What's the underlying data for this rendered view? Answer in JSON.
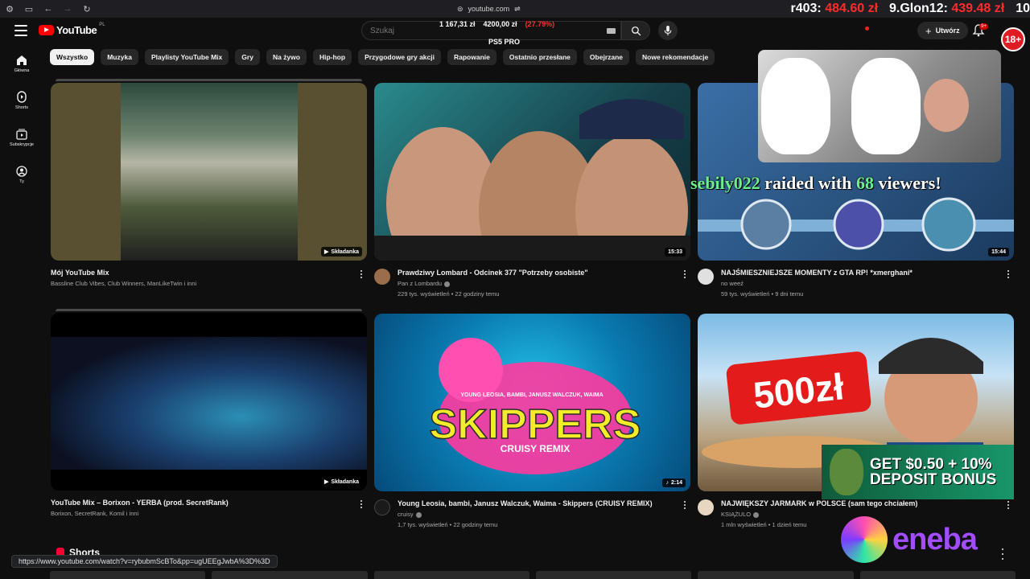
{
  "browser": {
    "url": "youtube.com",
    "status_url": "https://www.youtube.com/watch?v=rybubmScBTo&pp=ugUEEgJwbA%3D%3D"
  },
  "stream_overlay": {
    "ticker": [
      {
        "label": "r403:",
        "value": "484.60 zł"
      },
      {
        "label": "9.Glon12:",
        "value": "439.48 zł"
      },
      {
        "label": "10",
        "value": ""
      }
    ],
    "stock_left": "1 167,31 zł",
    "stock_mid": "4200,00 zł",
    "stock_change": "(27.79%)",
    "ps5": "PS5 PRO",
    "age_badge": "18+",
    "raid": {
      "name": "sebily022",
      "text1": "raided with",
      "count": "68",
      "text2": "viewers!"
    },
    "promo_text": "GET $0.50 + 10% DEPOSIT BONUS",
    "eneba": "eneba"
  },
  "header": {
    "logo": "YouTube",
    "region": "PL",
    "search_placeholder": "Szukaj",
    "create_label": "Utwórz",
    "notif_count": "9+"
  },
  "sidebar": {
    "items": [
      {
        "label": "Główna",
        "icon": "home-icon"
      },
      {
        "label": "Shorts",
        "icon": "shorts-icon"
      },
      {
        "label": "Subskrypcje",
        "icon": "subscriptions-icon"
      },
      {
        "label": "Ty",
        "icon": "you-icon"
      }
    ]
  },
  "chips": [
    "Wszystko",
    "Muzyka",
    "Playlisty YouTube Mix",
    "Gry",
    "Na żywo",
    "Hip-hop",
    "Przygodowe gry akcji",
    "Rapowanie",
    "Ostatnio przesłane",
    "Obejrzane",
    "Nowe rekomendacje"
  ],
  "videos": [
    {
      "title": "Mój YouTube Mix",
      "channel": "Bassline Club Vibes, Club Winners, ManLikeTwin i inni",
      "stats": "",
      "badge": "Składanka"
    },
    {
      "title": "Prawdziwy Lombard - Odcinek 377 \"Potrzeby osobiste\"",
      "channel": "Pan z Lombardu",
      "stats": "229 tys. wyświetleń • 22 godziny temu",
      "badge": "15:33"
    },
    {
      "title": "NAJŚMIESZNIEJSZE MOMENTY z GTA RP! *xmerghani*",
      "channel": "no weeź",
      "stats": "59 tys. wyświetleń • 9 dni temu",
      "badge": "15:44"
    },
    {
      "title": "YouTube Mix – Borixon - YERBA (prod. SecretRank)",
      "channel": "Borixon, SecretRank, Komil i inni",
      "stats": "",
      "badge": "Składanka"
    },
    {
      "title": "Young Leosia, bambi, Janusz Walczuk, Waima - Skippers (CRUISY REMIX)",
      "channel": "cruisy",
      "stats": "1,7 tys. wyświetleń • 22 godziny temu",
      "badge": "2:14"
    },
    {
      "title": "NAJWIĘKSZY JARMARK w POLSCE (sam tego chciałem)",
      "channel": "KSIĄŻULO",
      "stats": "1 mln wyświetleń • 1 dzień temu",
      "badge": ""
    }
  ],
  "thumb_text": {
    "skippers": "SKIPPERS",
    "skippers_sub": "CRUISY REMIX",
    "skippers_artists": "YOUNG LEOSIA, BAMBI, JANUSZ WALCZUK, WAIMA",
    "price": "500zł"
  },
  "shorts": {
    "label": "Shorts"
  }
}
